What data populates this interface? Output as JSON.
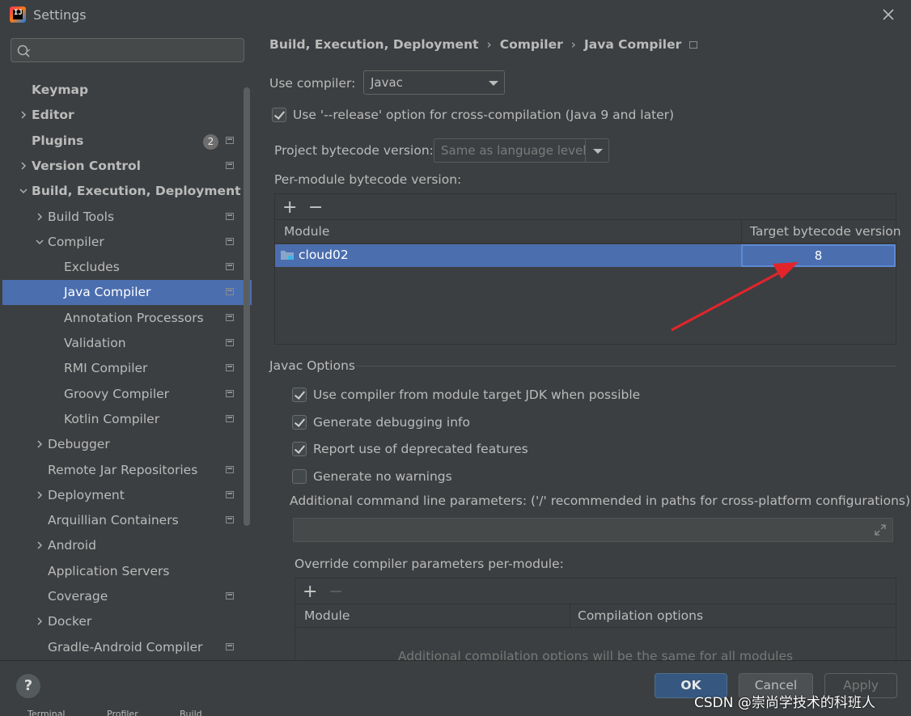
{
  "window": {
    "title": "Settings"
  },
  "search": {
    "placeholder": ""
  },
  "sidebar": {
    "items": [
      {
        "label": "Keymap",
        "bold": true,
        "level": 0,
        "chevron": "none",
        "proj": false
      },
      {
        "label": "Editor",
        "bold": true,
        "level": 0,
        "chevron": "right",
        "proj": false
      },
      {
        "label": "Plugins",
        "bold": true,
        "level": 0,
        "chevron": "none",
        "proj": true,
        "badge": "2"
      },
      {
        "label": "Version Control",
        "bold": true,
        "level": 0,
        "chevron": "right",
        "proj": true
      },
      {
        "label": "Build, Execution, Deployment",
        "bold": true,
        "level": 0,
        "chevron": "down",
        "proj": false
      },
      {
        "label": "Build Tools",
        "bold": false,
        "level": 1,
        "chevron": "right",
        "proj": true
      },
      {
        "label": "Compiler",
        "bold": false,
        "level": 1,
        "chevron": "down",
        "proj": true
      },
      {
        "label": "Excludes",
        "bold": false,
        "level": 2,
        "chevron": "none",
        "proj": true
      },
      {
        "label": "Java Compiler",
        "bold": false,
        "level": 2,
        "chevron": "none",
        "proj": true,
        "selected": true
      },
      {
        "label": "Annotation Processors",
        "bold": false,
        "level": 2,
        "chevron": "none",
        "proj": true
      },
      {
        "label": "Validation",
        "bold": false,
        "level": 2,
        "chevron": "none",
        "proj": true
      },
      {
        "label": "RMI Compiler",
        "bold": false,
        "level": 2,
        "chevron": "none",
        "proj": true
      },
      {
        "label": "Groovy Compiler",
        "bold": false,
        "level": 2,
        "chevron": "none",
        "proj": true
      },
      {
        "label": "Kotlin Compiler",
        "bold": false,
        "level": 2,
        "chevron": "none",
        "proj": true
      },
      {
        "label": "Debugger",
        "bold": false,
        "level": 1,
        "chevron": "right",
        "proj": false
      },
      {
        "label": "Remote Jar Repositories",
        "bold": false,
        "level": 1,
        "chevron": "none",
        "proj": true
      },
      {
        "label": "Deployment",
        "bold": false,
        "level": 1,
        "chevron": "right",
        "proj": true
      },
      {
        "label": "Arquillian Containers",
        "bold": false,
        "level": 1,
        "chevron": "none",
        "proj": true
      },
      {
        "label": "Android",
        "bold": false,
        "level": 1,
        "chevron": "right",
        "proj": false
      },
      {
        "label": "Application Servers",
        "bold": false,
        "level": 1,
        "chevron": "none",
        "proj": false
      },
      {
        "label": "Coverage",
        "bold": false,
        "level": 1,
        "chevron": "none",
        "proj": true
      },
      {
        "label": "Docker",
        "bold": false,
        "level": 1,
        "chevron": "right",
        "proj": false
      },
      {
        "label": "Gradle-Android Compiler",
        "bold": false,
        "level": 1,
        "chevron": "none",
        "proj": true
      }
    ]
  },
  "breadcrumb": {
    "part1": "Build, Execution, Deployment",
    "part2": "Compiler",
    "part3": "Java Compiler",
    "separator": "›"
  },
  "compiler": {
    "use_compiler_label": "Use compiler:",
    "use_compiler_value": "Javac",
    "release_option_label": "Use '--release' option for cross-compilation (Java 9 and later)",
    "release_option_checked": true,
    "project_bytecode_label": "Project bytecode version:",
    "project_bytecode_value": "Same as language level",
    "per_module_label": "Per-module bytecode version:"
  },
  "module_table": {
    "plus": "+",
    "minus": "−",
    "col_module": "Module",
    "col_target": "Target bytecode version",
    "rows": [
      {
        "module": "cloud02",
        "target": "8"
      }
    ]
  },
  "javac_options": {
    "section_title": "Javac Options",
    "options": [
      {
        "label": "Use compiler from module target JDK when possible",
        "checked": true
      },
      {
        "label": "Generate debugging info",
        "checked": true
      },
      {
        "label": "Report use of deprecated features",
        "checked": true
      },
      {
        "label": "Generate no warnings",
        "checked": false
      }
    ],
    "additional_params_label": "Additional command line parameters:",
    "additional_params_hint": "('/' recommended in paths for cross-platform configurations)",
    "additional_params_value": "",
    "override_label": "Override compiler parameters per-module:",
    "override_col_module": "Module",
    "override_col_options": "Compilation options",
    "override_empty_text": "Additional compilation options will be the same for all modules"
  },
  "footer": {
    "help": "?",
    "ok": "OK",
    "cancel": "Cancel",
    "apply": "Apply"
  },
  "statusbar": {
    "terminal": "Terminal",
    "profiler": "Profiler",
    "build": "Build"
  },
  "watermark": "CSDN @崇尚学技术的科班人",
  "colors": {
    "selection": "#4b6eaf",
    "background": "#3c3f41",
    "annotation_arrow": "#e3242b"
  }
}
